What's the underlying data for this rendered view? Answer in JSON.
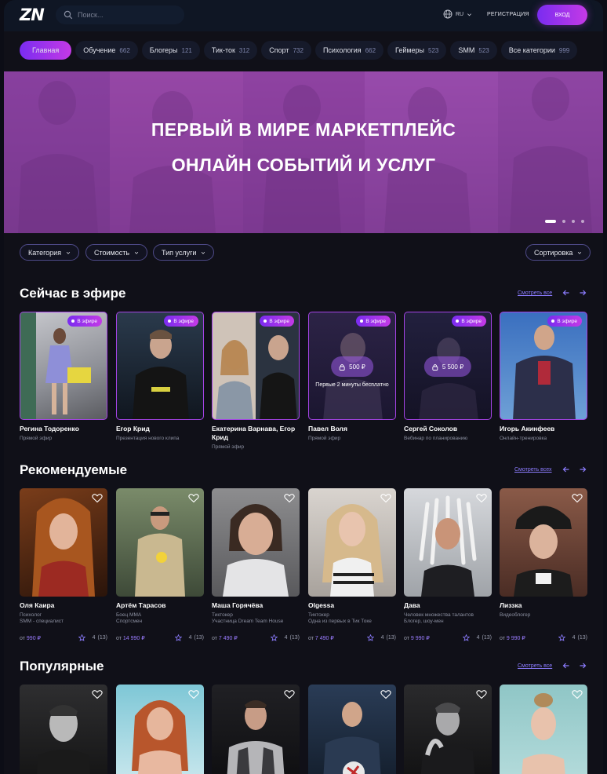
{
  "header": {
    "logo": "ZN",
    "search_placeholder": "Поиск...",
    "lang": "RU",
    "register": "РЕГИСТРАЦИЯ",
    "login": "ВХОД"
  },
  "categories": [
    {
      "label": "Главная",
      "count": ""
    },
    {
      "label": "Обучение",
      "count": "662"
    },
    {
      "label": "Блогеры",
      "count": "121"
    },
    {
      "label": "Тик-ток",
      "count": "312"
    },
    {
      "label": "Спорт",
      "count": "732"
    },
    {
      "label": "Психология",
      "count": "662"
    },
    {
      "label": "Геймеры",
      "count": "523"
    },
    {
      "label": "SMM",
      "count": "523"
    },
    {
      "label": "Все категории",
      "count": "999"
    }
  ],
  "hero": {
    "line1": "ПЕРВЫЙ В МИРЕ МАРКЕТПЛЕЙС",
    "line2": "ОНЛАЙН СОБЫТИЙ И УСЛУГ",
    "slides": 4,
    "active_slide": 1
  },
  "filters": {
    "category": "Категория",
    "cost": "Стоимость",
    "service_type": "Тип услуги",
    "sort": "Сортировка"
  },
  "live": {
    "title": "Сейчас в эфире",
    "see_all": "Смотреть все",
    "badge": "В эфире",
    "cards": [
      {
        "name": "Регина Тодоренко",
        "sub": "Прямой эфир"
      },
      {
        "name": "Егор Крид",
        "sub": "Презентация нового клипа"
      },
      {
        "name": "Екатерина Варнава, Егор Крид",
        "sub": "Прямой эфир"
      },
      {
        "name": "Павел Воля",
        "sub": "Прямой эфир",
        "price": "500 ₽",
        "note": "Первые 2 минуты бесплатно"
      },
      {
        "name": "Сергей Соколов",
        "sub": "Вебинар по планированию",
        "price": "5 500 ₽"
      },
      {
        "name": "Игорь Акинфеев",
        "sub": "Онлайн-тренировка"
      }
    ]
  },
  "recommended": {
    "title": "Рекомендуемые",
    "see_all": "Смотреть всех",
    "price_prefix": "от",
    "cards": [
      {
        "name": "Оля Каира",
        "sub1": "Психолог",
        "sub2": "SMM - специалист",
        "price": "990 ₽",
        "rating": "4",
        "reviews": "(13)"
      },
      {
        "name": "Артём Тарасов",
        "sub1": "Боец MMA",
        "sub2": "Спортсмен",
        "price": "14 990 ₽",
        "rating": "4",
        "reviews": "(13)"
      },
      {
        "name": "Маша Горячёва",
        "sub1": "Тиктокер",
        "sub2": "Участница Dream Team House",
        "price": "7 490 ₽",
        "rating": "4",
        "reviews": "(13)"
      },
      {
        "name": "Olgessa",
        "sub1": "Тиктокер",
        "sub2": "Одна из первых в Тик Токе",
        "price": "7 490 ₽",
        "rating": "4",
        "reviews": "(13)"
      },
      {
        "name": "Дава",
        "sub1": "Человек множества талантов",
        "sub2": "Блогер, шоу-мен",
        "price": "9 990 ₽",
        "rating": "4",
        "reviews": "(13)"
      },
      {
        "name": "Лиззка",
        "sub1": "Видеоблогер",
        "sub2": "",
        "price": "9 990 ₽",
        "rating": "4",
        "reviews": "(13)"
      }
    ]
  },
  "popular": {
    "title": "Популярные",
    "see_all": "Смотреть все"
  },
  "colors": {
    "accent_start": "#7a2cf0",
    "accent_end": "#c43ae6",
    "link": "#8c7cff",
    "background": "#101018"
  }
}
